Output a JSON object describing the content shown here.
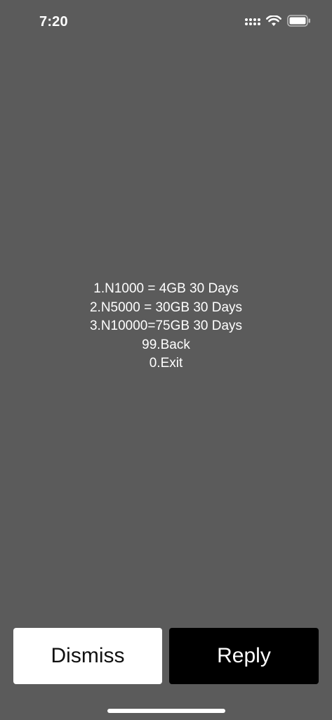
{
  "status_bar": {
    "time": "7:20",
    "icons": [
      "cellular-signal-icon",
      "wifi-icon",
      "battery-icon"
    ]
  },
  "ussd": {
    "lines": [
      "1.N1000 = 4GB 30 Days",
      "2.N5000 = 30GB 30 Days",
      "3.N10000=75GB 30 Days",
      "99.Back",
      "0.Exit"
    ]
  },
  "actions": {
    "dismiss_label": "Dismiss",
    "reply_label": "Reply"
  },
  "colors": {
    "background": "#5b5b5b",
    "dismiss_bg": "#ffffff",
    "reply_bg": "#000000",
    "text": "#ffffff"
  }
}
